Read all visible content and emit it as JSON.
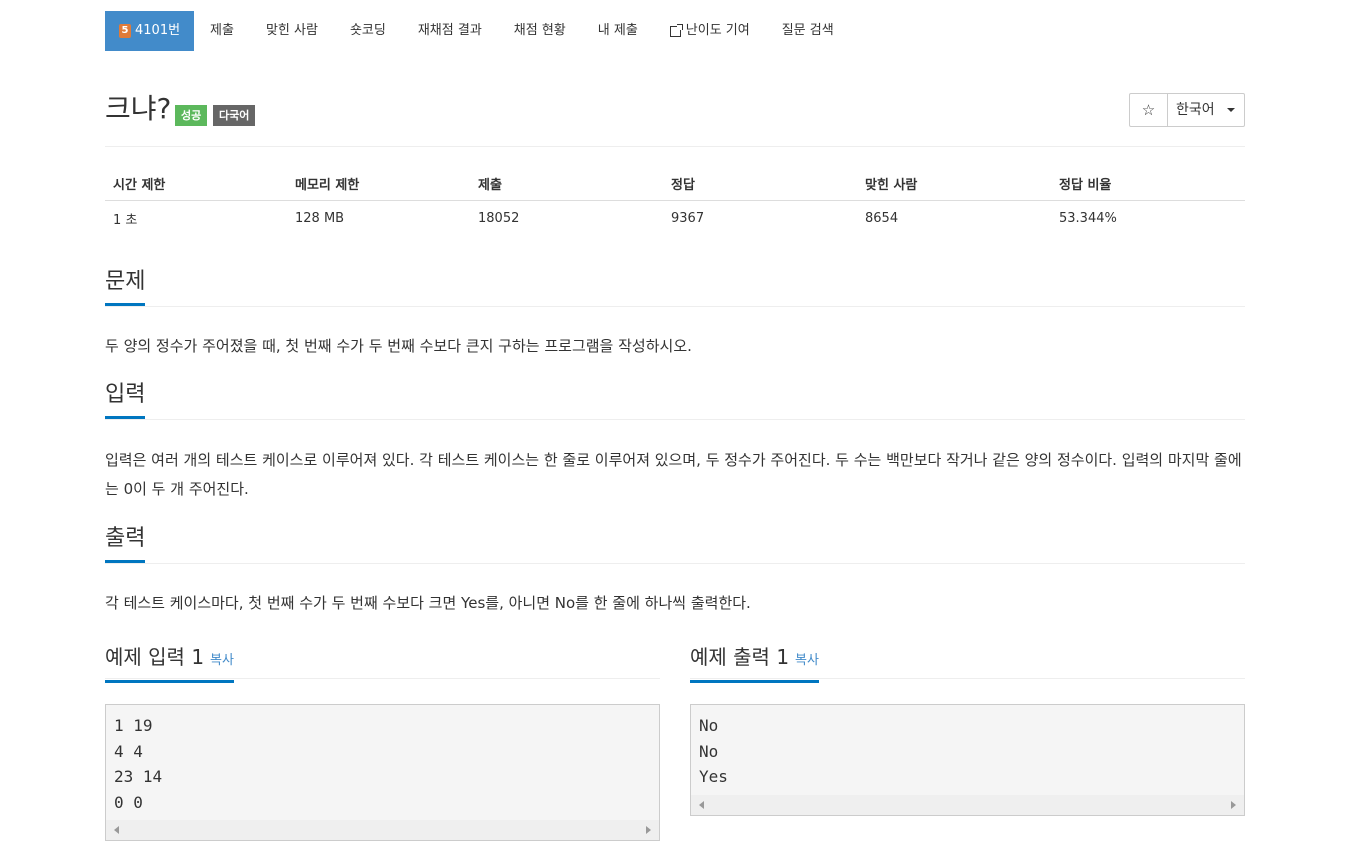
{
  "nav": {
    "problem_tier": "5",
    "problem_number": "4101번",
    "items": [
      "제출",
      "맞힌 사람",
      "숏코딩",
      "재채점 결과",
      "채점 현황",
      "내 제출",
      "난이도 기여",
      "질문 검색"
    ]
  },
  "problem": {
    "title": "크냐?",
    "badge_success": "성공",
    "badge_multi": "다국어",
    "star": "☆",
    "language": "한국어"
  },
  "stats": {
    "headers": [
      "시간 제한",
      "메모리 제한",
      "제출",
      "정답",
      "맞힌 사람",
      "정답 비율"
    ],
    "values": [
      "1 초",
      "128 MB",
      "18052",
      "9367",
      "8654",
      "53.344%"
    ]
  },
  "sections": {
    "description": {
      "title": "문제",
      "body": "두 양의 정수가 주어졌을 때, 첫 번째 수가 두 번째 수보다 큰지 구하는 프로그램을 작성하시오."
    },
    "input": {
      "title": "입력",
      "body": "입력은 여러 개의 테스트 케이스로 이루어져 있다. 각 테스트 케이스는 한 줄로 이루어져 있으며, 두 정수가 주어진다. 두 수는 백만보다 작거나 같은 양의 정수이다. 입력의 마지막 줄에는 0이 두 개 주어진다."
    },
    "output": {
      "title": "출력",
      "body": "각 테스트 케이스마다, 첫 번째 수가 두 번째 수보다 크면 Yes를, 아니면 No를 한 줄에 하나씩 출력한다."
    }
  },
  "examples": {
    "input": {
      "title": "예제 입력 1",
      "copy": "복사",
      "lines": [
        "1 19",
        "4 4",
        "23 14",
        "0 0"
      ]
    },
    "output": {
      "title": "예제 출력 1",
      "copy": "복사",
      "lines": [
        "No",
        "No",
        "Yes"
      ]
    }
  },
  "colors": {
    "accent": "#428bca",
    "section_underline": "#0076c0",
    "success": "#5cb85c",
    "multi": "#666666",
    "tier": "#e07b39"
  }
}
